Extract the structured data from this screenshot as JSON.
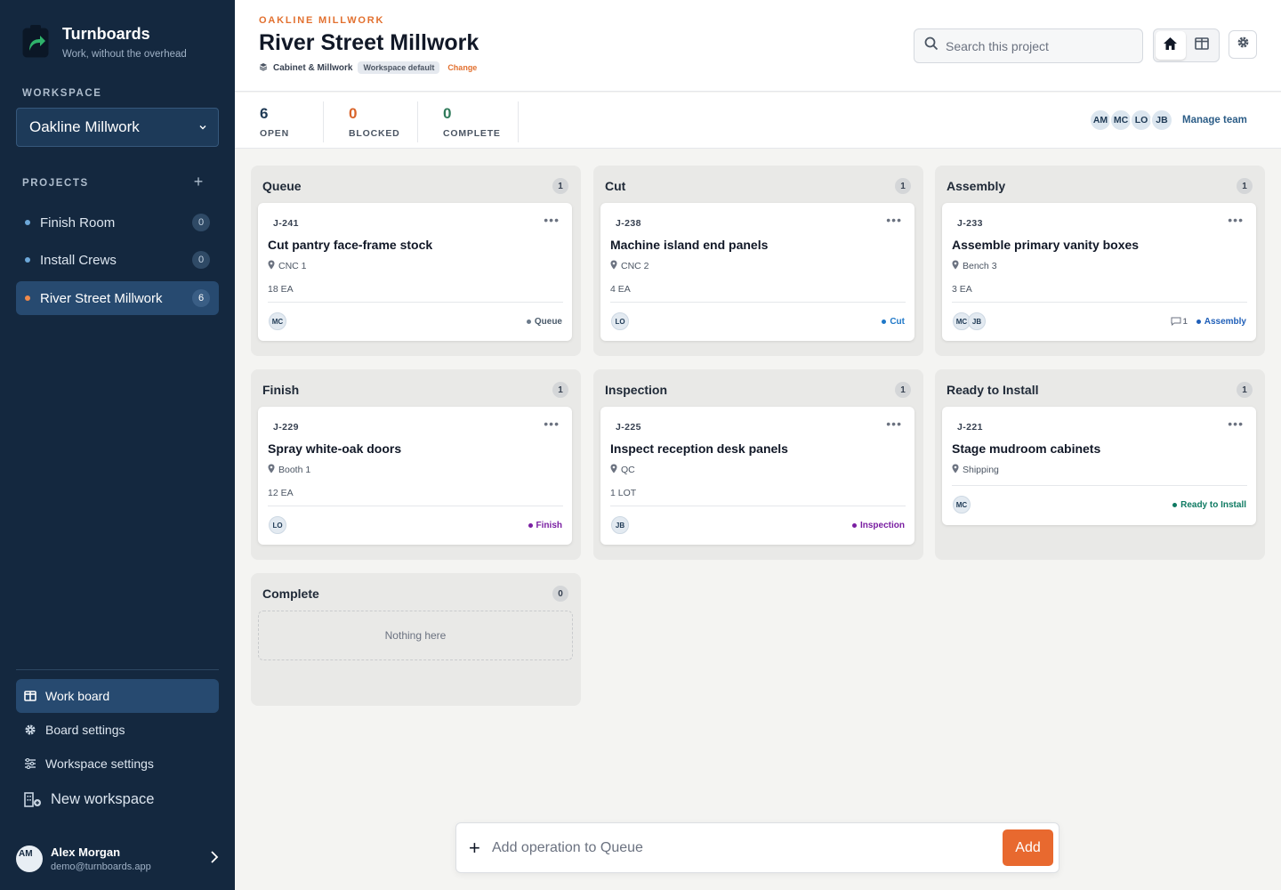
{
  "brand": {
    "name": "Turnboards",
    "tagline": "Work, without the overhead"
  },
  "sidebar": {
    "workspace_label": "WORKSPACE",
    "workspace_selected": "Oakline Millwork",
    "projects_label": "PROJECTS",
    "projects": [
      {
        "name": "Finish Room",
        "count": "0"
      },
      {
        "name": "Install Crews",
        "count": "0"
      },
      {
        "name": "River Street Millwork",
        "count": "6"
      }
    ],
    "nav": {
      "work_board": "Work board",
      "board_settings": "Board settings",
      "workspace_settings": "Workspace settings",
      "new_workspace": "New workspace"
    },
    "user": {
      "initials": "AM",
      "name": "Alex Morgan",
      "email": "demo@turnboards.app"
    }
  },
  "header": {
    "eyebrow": "OAKLINE MILLWORK",
    "title": "River Street Millwork",
    "category": "Cabinet & Millwork",
    "badge": "Workspace default",
    "change": "Change",
    "search_placeholder": "Search this project"
  },
  "stats": {
    "open": {
      "value": "6",
      "label": "OPEN"
    },
    "blocked": {
      "value": "0",
      "label": "BLOCKED"
    },
    "complete": {
      "value": "0",
      "label": "COMPLETE"
    }
  },
  "team": {
    "members": [
      "AM",
      "MC",
      "LO",
      "JB"
    ],
    "manage_label": "Manage team"
  },
  "columns": [
    {
      "name": "Queue",
      "count": "1",
      "card": {
        "id": "J-241",
        "title": "Cut pantry face-frame stock",
        "location": "CNC 1",
        "qty": "18 EA",
        "assignees": [
          "MC"
        ],
        "status": "Queue",
        "status_color": "#6b7a8a"
      }
    },
    {
      "name": "Cut",
      "count": "1",
      "card": {
        "id": "J-238",
        "title": "Machine island end panels",
        "location": "CNC 2",
        "qty": "4 EA",
        "assignees": [
          "LO"
        ],
        "status": "Cut",
        "status_color": "#1f78c8"
      }
    },
    {
      "name": "Assembly",
      "count": "1",
      "card": {
        "id": "J-233",
        "title": "Assemble primary vanity boxes",
        "location": "Bench 3",
        "qty": "3 EA",
        "assignees": [
          "MC",
          "JB"
        ],
        "comments": "1",
        "status": "Assembly",
        "status_color": "#1f5fb8"
      }
    },
    {
      "name": "Finish",
      "count": "1",
      "card": {
        "id": "J-229",
        "title": "Spray white-oak doors",
        "location": "Booth 1",
        "qty": "12 EA",
        "assignees": [
          "LO"
        ],
        "status": "Finish",
        "status_color": "#7a1fa2"
      }
    },
    {
      "name": "Inspection",
      "count": "1",
      "card": {
        "id": "J-225",
        "title": "Inspect reception desk panels",
        "location": "QC",
        "qty": "1 LOT",
        "assignees": [
          "JB"
        ],
        "status": "Inspection",
        "status_color": "#7a1fa2"
      }
    },
    {
      "name": "Ready to Install",
      "count": "1",
      "card": {
        "id": "J-221",
        "title": "Stage mudroom cabinets",
        "location": "Shipping",
        "qty": "",
        "assignees": [
          "MC"
        ],
        "status": "Ready to Install",
        "status_color": "#0f7a62"
      }
    },
    {
      "name": "Complete",
      "count": "0",
      "empty_text": "Nothing here"
    }
  ],
  "add_bar": {
    "placeholder": "Add operation to Queue",
    "button": "Add"
  },
  "colors": {
    "sidebar": "#14283f",
    "accent": "#e8692f",
    "blocked": "#d9642a",
    "complete": "#2f7a5a"
  }
}
